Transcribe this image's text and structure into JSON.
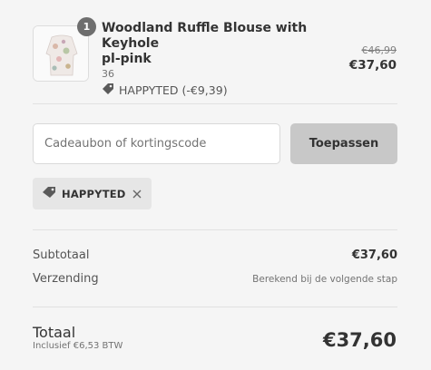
{
  "cart_item": {
    "name_line1": "Woodland Ruffle Blouse with Keyhole",
    "name_line2": "pl-pink",
    "variant": "36",
    "quantity": "1",
    "discount_label": "HAPPYTED (-€9,39)",
    "original_price": "€46,99",
    "price": "€37,60"
  },
  "discount_form": {
    "placeholder": "Cadeaubon of kortingscode",
    "apply_label": "Toepassen",
    "applied_code": "HAPPYTED"
  },
  "summary": {
    "subtotal_label": "Subtotaal",
    "subtotal_value": "€37,60",
    "shipping_label": "Verzending",
    "shipping_value": "Berekend bij de volgende stap",
    "total_label": "Totaal",
    "tax_note": "Inclusief €6,53 BTW",
    "total_value": "€37,60"
  },
  "icons": {
    "tag": "tag-icon",
    "remove": "close-icon"
  },
  "colors": {
    "background": "#f5f5f5",
    "button": "#c8c8c8",
    "badge": "#6e6e6e",
    "tag_bg": "#e6e6e6"
  }
}
